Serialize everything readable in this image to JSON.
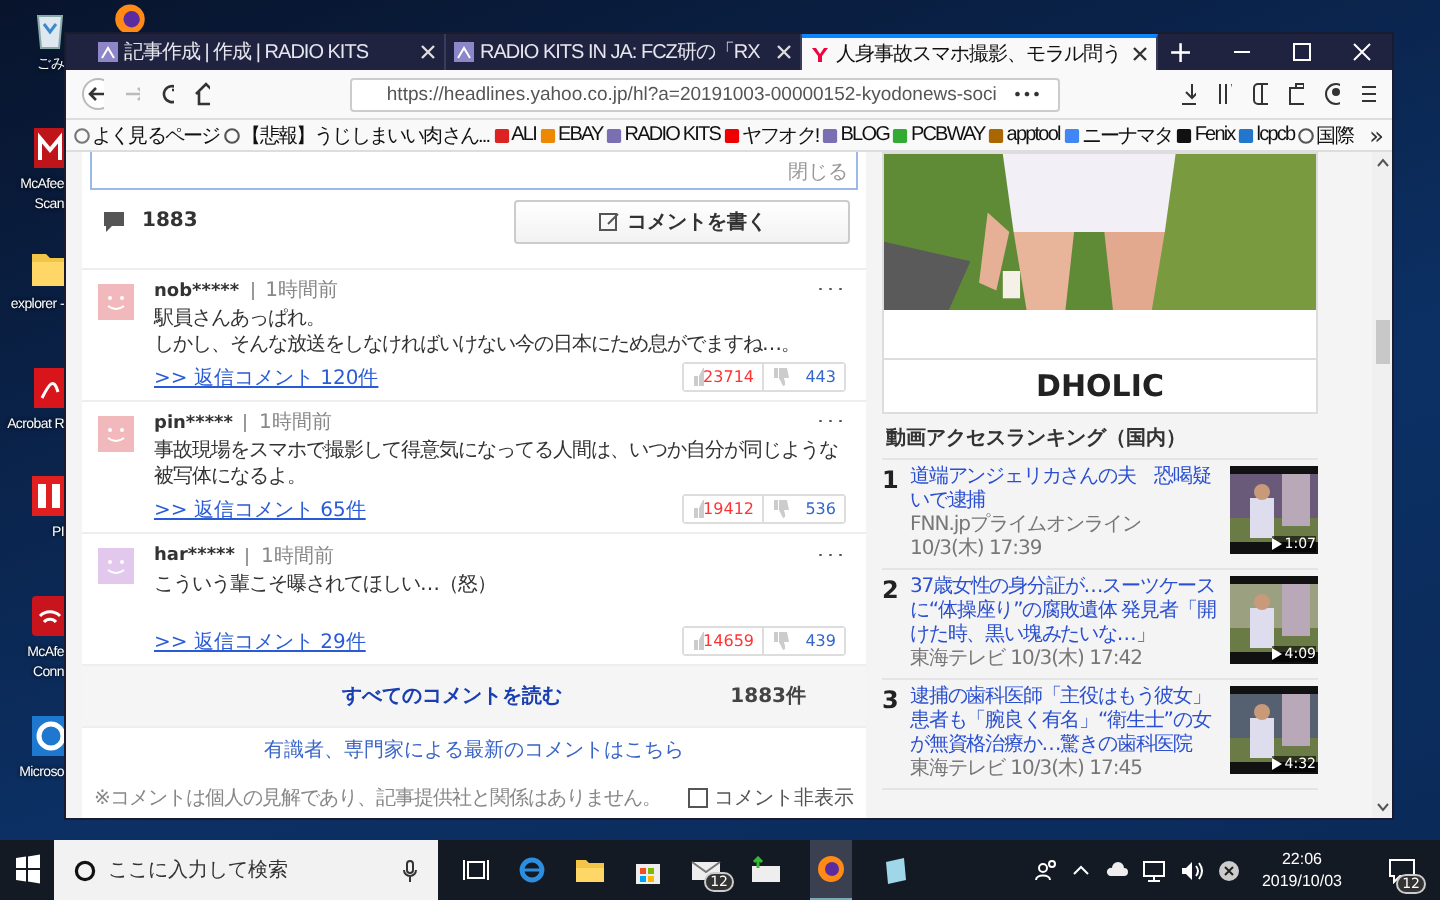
{
  "desktop": {
    "icons": [
      {
        "kind": "recycle",
        "lines": [
          "ごみ"
        ]
      },
      {
        "kind": "firefox"
      },
      {
        "kind": "mcafee",
        "lines": [
          "McAfee",
          "Scan"
        ]
      },
      {
        "kind": "folder",
        "lines": [
          "explorer -"
        ]
      },
      {
        "kind": "pdf",
        "lines": [
          "Acrobat R"
        ]
      },
      {
        "kind": "redapp",
        "lines": [
          "PI"
        ]
      },
      {
        "kind": "wifi",
        "lines": [
          "McAfe",
          "Conn"
        ]
      },
      {
        "kind": "edge",
        "lines": [
          "Microso"
        ]
      }
    ]
  },
  "browser": {
    "tabs": [
      {
        "title": "記事作成 | 作成 | RADIO KITS",
        "selected": false
      },
      {
        "title": "RADIO KITS IN JA: FCZ研の「RX",
        "selected": false
      },
      {
        "title": "人身事故スマホ撮影、モラル問う",
        "selected": true
      }
    ],
    "new_tab": "+",
    "url": "https://headlines.yahoo.co.jp/hl?a=20191003-00000152-kyodonews-soci",
    "page_actions": "•••",
    "bookmarks": [
      {
        "label": "よく見るページ"
      },
      {
        "label": "【悲報】うじしまいい肉さん..."
      },
      {
        "label": "ALI"
      },
      {
        "label": "EBAY"
      },
      {
        "label": "RADIO KITS"
      },
      {
        "label": "ヤフオク!"
      },
      {
        "label": "BLOG"
      },
      {
        "label": "PCBWAY"
      },
      {
        "label": "apptool"
      },
      {
        "label": "ニーナマタ"
      },
      {
        "label": "Fenix"
      },
      {
        "label": "lcpcb"
      },
      {
        "label": "国際"
      }
    ],
    "bookmarks_more": "»"
  },
  "comments_panel": {
    "close": "閉じる",
    "count": "1883",
    "write_button": "コメントを書く",
    "comments": [
      {
        "user": "nob*****",
        "time": "1時間前",
        "color": "#f2b9bd",
        "lines": [
          "駅員さんあっぱれ。",
          "しかし、そんな放送をしなければいけない今の日本にため息がでますね…。"
        ],
        "replies": ">> 返信コメント 120件",
        "likes": "23714",
        "dislikes": "443",
        "more": "･･･"
      },
      {
        "user": "pin*****",
        "time": "1時間前",
        "color": "#f2b9bd",
        "lines": [
          "事故現場をスマホで撮影して得意気になってる人間は、いつか自分が同じような被写体になるよ。"
        ],
        "replies": ">> 返信コメント 65件",
        "likes": "19412",
        "dislikes": "536",
        "more": "･･･"
      },
      {
        "user": "har*****",
        "time": "1時間前",
        "color": "#e3c8ee",
        "lines": [
          "こういう輩こそ曝されてほしい…（怒）"
        ],
        "replies": ">> 返信コメント 29件",
        "likes": "14659",
        "dislikes": "439",
        "more": "･･･"
      }
    ],
    "read_all": "すべてのコメントを読む",
    "total": "1883件",
    "experts_link": "有識者、専門家による最新のコメントはこちら",
    "note": "※コメントは個人の見解であり、記事提供社と関係はありません。",
    "hide_checkbox": {
      "label": "コメント非表示",
      "checked": false
    }
  },
  "sidebar": {
    "ad": {
      "brand": "DHOLIC"
    },
    "ranking": {
      "title": "動画アクセスランキング（国内）",
      "items": [
        {
          "rank": "1",
          "title": "道端アンジェリカさんの夫　恐喝疑いで逮捕",
          "meta": [
            "FNN.jpプライムオンライン",
            "10/3(木) 17:39"
          ],
          "duration": "1:07"
        },
        {
          "rank": "2",
          "title": "37歳女性の身分証が…スーツケースに“体操座り”の腐敗遺体 発見者「開けた時、黒い塊みたいな…」",
          "meta": [
            "東海テレビ 10/3(木) 17:42"
          ],
          "duration": "4:09"
        },
        {
          "rank": "3",
          "title": "逮捕の歯科医師「主役はもう彼女」患者も「腕良く有名」“衛生士”の女が無資格治療か…驚きの歯科医院",
          "meta": [
            "東海テレビ 10/3(木) 17:45"
          ],
          "duration": "4:32"
        }
      ]
    }
  },
  "taskbar": {
    "search_placeholder": "ここに入力して検索",
    "mail_badge": "12",
    "time": "22:06",
    "date": "2019/10/03",
    "notification_badge": "12"
  }
}
